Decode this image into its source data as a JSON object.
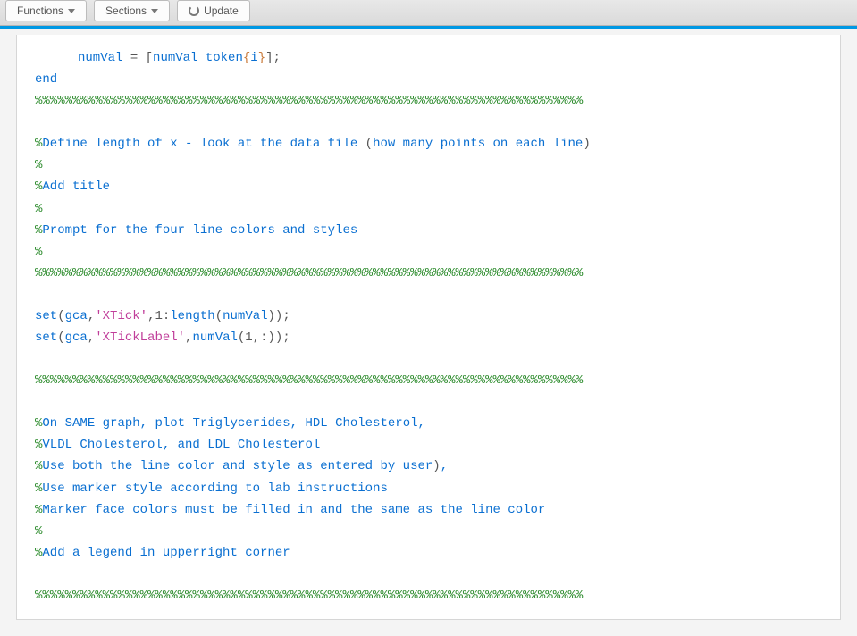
{
  "toolbar": {
    "functions_label": "Functions",
    "sections_label": "Sections",
    "update_label": "Update"
  },
  "code": {
    "l01_a": "numVal",
    "l01_b": " = ",
    "l01_c": "[",
    "l01_d": "numVal token",
    "l01_e": "{",
    "l01_f": "i",
    "l01_g": "}",
    "l01_h": "]",
    "l01_i": ";",
    "l02": "end",
    "sep1": "%%%%%%%%%%%%%%%%%%%%%%%%%%%%%%%%%%%%%%%%%%%%%%%%%%%%%%%%%%%%%%%%%%%%%%%%%",
    "blank": "",
    "c1_a": "%",
    "c1_b": "Define length of x - look at the data file ",
    "c1_c": "(",
    "c1_d": "how many points on each line",
    "c1_e": ")",
    "c2": "%",
    "c3_a": "%",
    "c3_b": "Add title",
    "c4": "%",
    "c5_a": "%",
    "c5_b": "Prompt for the four line colors and styles",
    "c6": "%",
    "sep2": "%%%%%%%%%%%%%%%%%%%%%%%%%%%%%%%%%%%%%%%%%%%%%%%%%%%%%%%%%%%%%%%%%%%%%%%%%",
    "s1_a": "set",
    "s1_b": "(",
    "s1_c": "gca",
    "s1_d": ",",
    "s1_e": "'XTick'",
    "s1_f": ",1:",
    "s1_g": "length",
    "s1_h": "(",
    "s1_i": "numVal",
    "s1_j": "));",
    "s2_a": "set",
    "s2_b": "(",
    "s2_c": "gca",
    "s2_d": ",",
    "s2_e": "'XTickLabel'",
    "s2_f": ",",
    "s2_g": "numVal",
    "s2_h": "(1,:));",
    "sep3": "%%%%%%%%%%%%%%%%%%%%%%%%%%%%%%%%%%%%%%%%%%%%%%%%%%%%%%%%%%%%%%%%%%%%%%%%%",
    "p1_a": "%",
    "p1_b": "On ",
    "p1_c": "SAME",
    "p1_d": " graph, plot Triglycerides, HDL Cholesterol,",
    "p2_a": "%",
    "p2_b": "VLDL Cholesterol, and LDL Cholesterol",
    "p3_a": "%",
    "p3_b": "Use both the line color and style as entered by user",
    "p3_c": ")",
    "p3_d": ",",
    "p4_a": "%",
    "p4_b": "Use marker style according to lab instructions",
    "p5_a": "%",
    "p5_b": "Marker face colors must be filled in and the same as the line color",
    "p6": "%",
    "p7_a": "%",
    "p7_b": "Add a legend in upperright corner",
    "sep4": "%%%%%%%%%%%%%%%%%%%%%%%%%%%%%%%%%%%%%%%%%%%%%%%%%%%%%%%%%%%%%%%%%%%%%%%%%"
  }
}
